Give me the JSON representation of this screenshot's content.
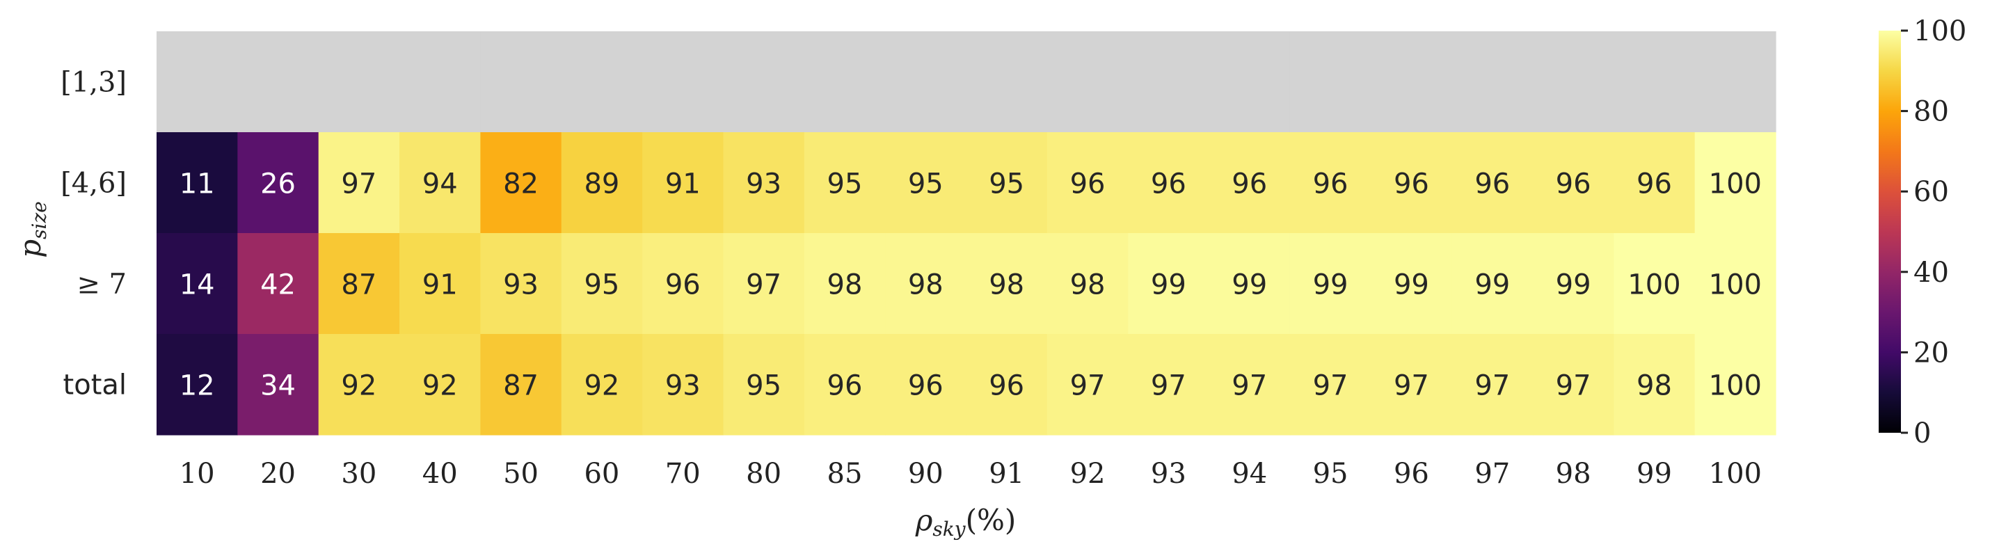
{
  "chart_data": {
    "type": "heatmap",
    "colormap": "inferno",
    "x_categories": [
      "10",
      "20",
      "30",
      "40",
      "50",
      "60",
      "70",
      "80",
      "85",
      "90",
      "91",
      "92",
      "93",
      "94",
      "95",
      "96",
      "97",
      "98",
      "99",
      "100"
    ],
    "y_categories": [
      "[1,3]",
      "[4,6]",
      "≥ 7",
      "total"
    ],
    "values": [
      [
        null,
        null,
        null,
        null,
        null,
        null,
        null,
        null,
        null,
        null,
        null,
        null,
        null,
        null,
        null,
        null,
        null,
        null,
        null,
        null
      ],
      [
        11,
        26,
        97,
        94,
        82,
        89,
        91,
        93,
        95,
        95,
        95,
        96,
        96,
        96,
        96,
        96,
        96,
        96,
        96,
        100
      ],
      [
        14,
        42,
        87,
        91,
        93,
        95,
        96,
        97,
        98,
        98,
        98,
        98,
        99,
        99,
        99,
        99,
        99,
        99,
        100,
        100
      ],
      [
        12,
        34,
        92,
        92,
        87,
        92,
        93,
        95,
        96,
        96,
        96,
        97,
        97,
        97,
        97,
        97,
        97,
        97,
        98,
        100
      ]
    ],
    "missing_color": "#d3d3d3",
    "xlabel_base": "ρ",
    "xlabel_sub": "sky",
    "xlabel_suffix": "(%)",
    "ylabel_base": "p",
    "ylabel_sub": "size",
    "colorbar": {
      "range": [
        0,
        100
      ],
      "ticks": [
        "0",
        "20",
        "40",
        "60",
        "80",
        "100"
      ]
    }
  }
}
